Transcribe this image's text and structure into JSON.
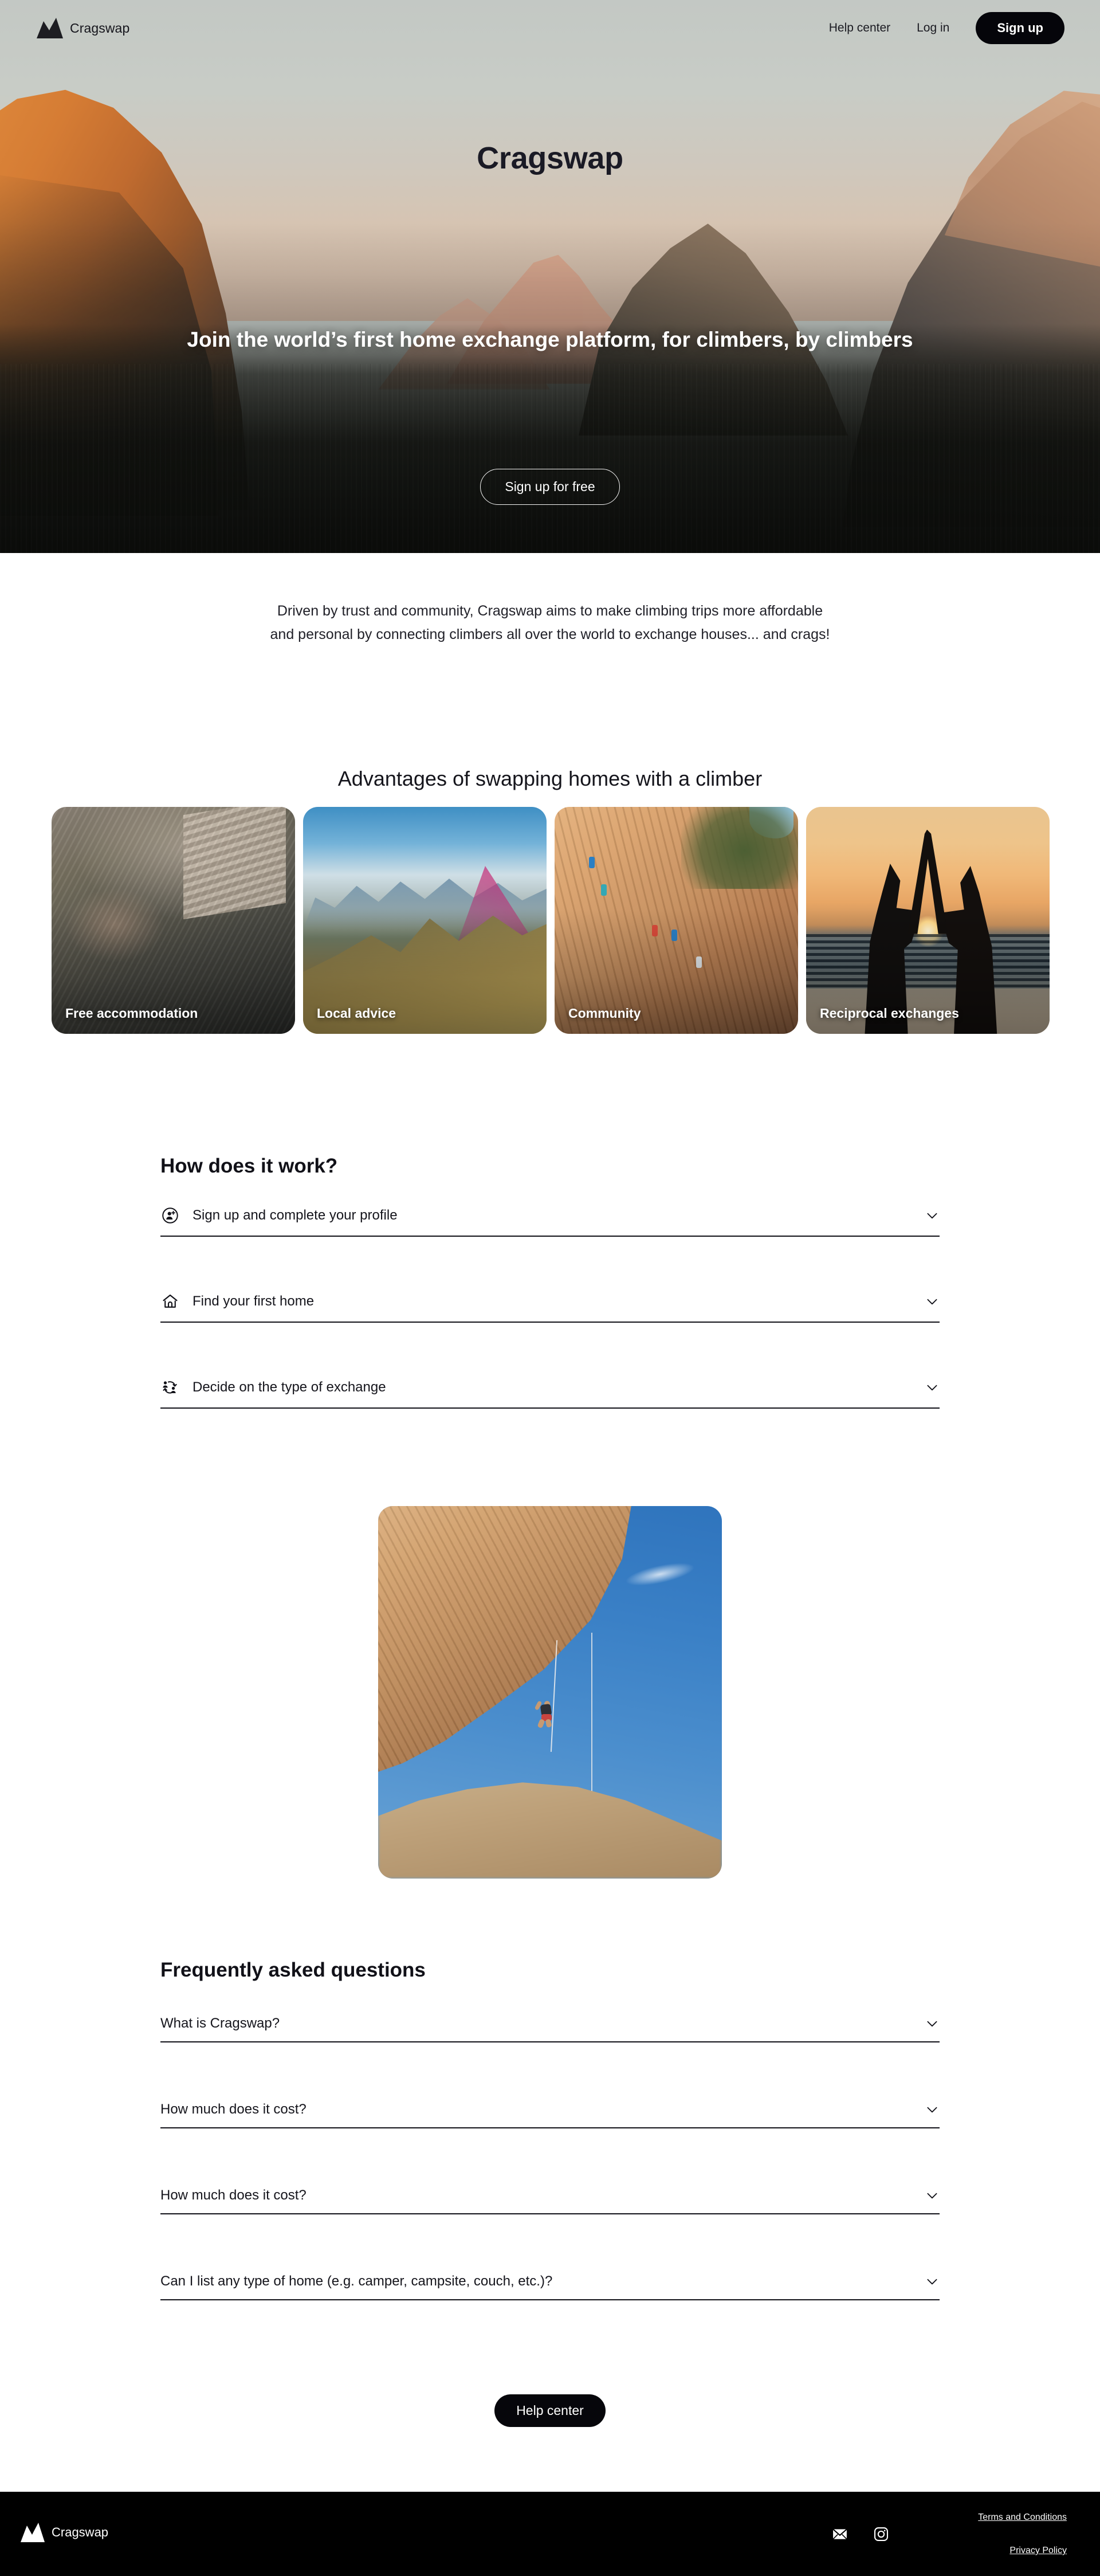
{
  "brand": {
    "name": "Cragswap",
    "logo_icon": "mountain-logo-icon"
  },
  "header": {
    "nav": [
      {
        "label": "Help center",
        "name": "nav-help-center"
      },
      {
        "label": "Log in",
        "name": "nav-log-in"
      }
    ],
    "signup_label": "Sign up"
  },
  "hero": {
    "title": "Cragswap",
    "subtitle": "Join the world’s first home exchange platform, for climbers, by climbers",
    "cta_label": "Sign up for free",
    "background": "yosemite-valley-sunset-photo"
  },
  "intro": {
    "paragraph": "Driven by trust and community, Cragswap aims to make climbing trips more affordable and personal by connecting climbers all over the world to exchange houses... and crags!"
  },
  "advantages": {
    "title": "Advantages of swapping homes with a climber",
    "cards": [
      {
        "label": "Free accommodation",
        "image": "person-sleeping-in-bed-photo"
      },
      {
        "label": "Local advice",
        "image": "climbers-on-alpine-ridge-photo"
      },
      {
        "label": "Community",
        "image": "climbers-on-sandstone-crag-photo"
      },
      {
        "label": "Reciprocal exchanges",
        "image": "two-people-high-five-sunset-beach-photo"
      }
    ]
  },
  "how_it_works": {
    "title": "How does it work?",
    "items": [
      {
        "label": "Sign up and complete your profile",
        "icon": "person-add-circle-icon"
      },
      {
        "label": "Find your first home",
        "icon": "house-icon"
      },
      {
        "label": "Decide on the type of exchange",
        "icon": "people-exchange-icon"
      }
    ]
  },
  "feature_photo": {
    "image": "climber-hanging-on-rope-overhang-photo"
  },
  "faq": {
    "title": "Frequently asked questions",
    "items": [
      {
        "question": "What is Cragswap?"
      },
      {
        "question": "How much does it cost?"
      },
      {
        "question": "How much does it cost?"
      },
      {
        "question": "Can I list any type of home (e.g. camper, campsite, couch, etc.)?"
      }
    ]
  },
  "help_cta": {
    "label": "Help center"
  },
  "footer": {
    "brand_name": "Cragswap",
    "socials": [
      {
        "name": "email-icon",
        "label": "Email"
      },
      {
        "name": "instagram-icon",
        "label": "Instagram"
      }
    ],
    "links": [
      {
        "label": "Terms and Conditions",
        "name": "footer-link-terms"
      },
      {
        "label": "Privacy Policy",
        "name": "footer-link-privacy"
      }
    ]
  },
  "colors": {
    "accent_dark": "#05050a",
    "text": "#15151c",
    "footer_bg": "#000000",
    "page_bg": "#ffffff"
  }
}
